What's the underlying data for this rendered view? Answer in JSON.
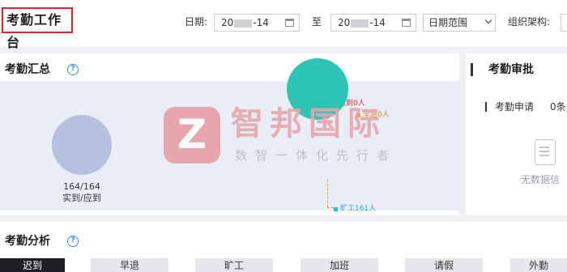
{
  "header": {
    "title": "考勤工作台",
    "date_label": "日期:",
    "date_start_prefix": "20",
    "date_start_suffix": "-14",
    "to_label": "至",
    "date_end_prefix": "20",
    "date_end_suffix": "-14",
    "range_select": "日期范围",
    "org_label": "组织架构:"
  },
  "summary": {
    "title": "考勤汇总",
    "help": "?",
    "count": "164/164",
    "count_label": "实到/应到",
    "legend": [
      {
        "label": "迟到0人",
        "color": "#d9262b"
      },
      {
        "label": "早退0人",
        "color": "#e8a53a"
      },
      {
        "label": "旷工161人",
        "color": "#2ec4b6"
      }
    ]
  },
  "watermark": {
    "logo_letter": "Z",
    "name": "智邦国际",
    "slogan": "数智一体化先行者"
  },
  "approval": {
    "title": "考勤审批",
    "apply_label": "考勤申请",
    "apply_count": "0条",
    "empty_text": "无数据信"
  },
  "analysis": {
    "title": "考勤分析",
    "help": "?",
    "tabs": [
      "迟到",
      "早退",
      "旷工",
      "加班",
      "请假",
      "外勤"
    ]
  }
}
